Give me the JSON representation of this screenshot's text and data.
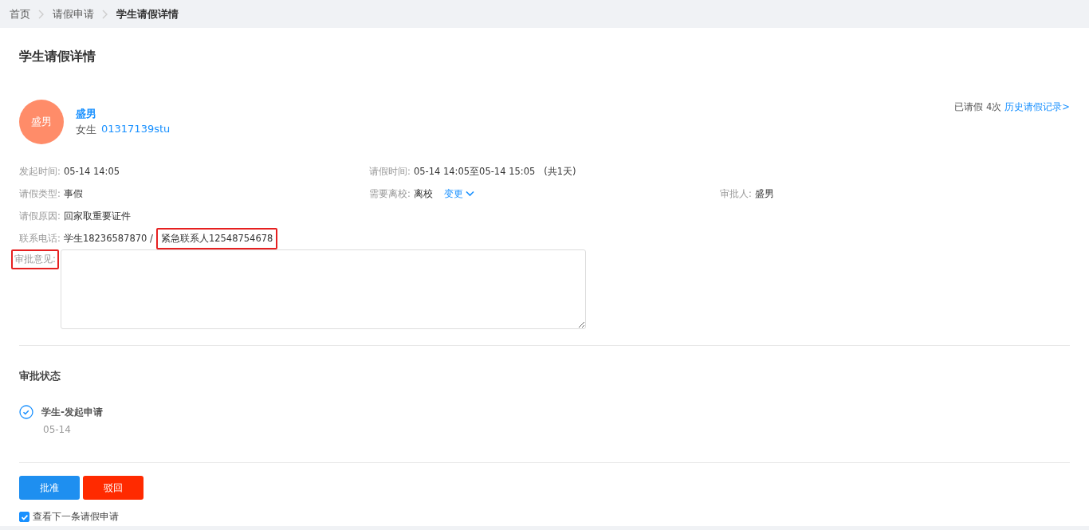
{
  "breadcrumb": [
    {
      "label": "首页",
      "current": false
    },
    {
      "label": "请假申请",
      "current": false
    },
    {
      "label": "学生请假详情",
      "current": true
    }
  ],
  "title": "学生请假详情",
  "student": {
    "avatar_text": "盛男",
    "name": "盛男",
    "gender": "女生",
    "id": "01317139stu"
  },
  "leave_summary": {
    "count": "已请假 4次",
    "link": "历史请假记录>"
  },
  "field_rows": [
    [
      {
        "label": "发起时间:",
        "parts": [
          {
            "text": "05-14 14:05",
            "highlighted": false
          }
        ]
      },
      {
        "label": "请假时间:",
        "parts": [
          {
            "text": "05-14 14:05至05-14 15:05   (共1天)",
            "highlighted": false
          }
        ]
      }
    ],
    [
      {
        "label": "请假类型:",
        "parts": [
          {
            "text": "事假",
            "highlighted": false
          }
        ]
      },
      {
        "label": "需要离校:",
        "parts": [
          {
            "text": "离校",
            "highlighted": false
          }
        ],
        "action": "变更"
      },
      {
        "label": "审批人:",
        "parts": [
          {
            "text": "盛男",
            "highlighted": false
          }
        ]
      }
    ],
    [
      {
        "label": "请假原因:",
        "parts": [
          {
            "text": "回家取重要证件",
            "highlighted": false
          }
        ]
      }
    ],
    [
      {
        "label": "联系电话:",
        "parts": [
          {
            "text": "学生18236587870 /",
            "highlighted": false
          },
          {
            "text": "紧急联系人12548754678",
            "highlighted": true
          }
        ]
      }
    ]
  ],
  "comment": {
    "label": "审批意见:",
    "label_highlighted": true
  },
  "status": {
    "title": "审批状态",
    "steps": [
      {
        "title": "学生-发起申请",
        "date": "05-14",
        "done": true
      }
    ]
  },
  "buttons": [
    {
      "label": "批准",
      "kind": "primary"
    },
    {
      "label": "驳回",
      "kind": "danger"
    }
  ],
  "next_checkbox": {
    "label": "查看下一条请假申请",
    "checked": true
  }
}
